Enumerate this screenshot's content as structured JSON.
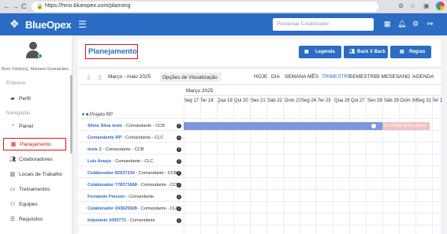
{
  "browser": {
    "back": "←",
    "forward": "→",
    "reload": "C",
    "url": "https://hmo.blueopex.com/planning"
  },
  "header": {
    "logo": "BlueOpex",
    "search_placeholder": "Pesquisar Colaborador"
  },
  "sidebar": {
    "welcome": "Bem Vindo(a), Mariane Guimarães",
    "section_empresa": "Empresa",
    "section_navegacao": "Navegação",
    "items": [
      {
        "label": "Perfil",
        "icon": "briefcase-icon"
      },
      {
        "label": "Painel",
        "icon": "dashboard-icon"
      },
      {
        "label": "Planejamento",
        "icon": "calendar-icon"
      },
      {
        "label": "Colaboradores",
        "icon": "users-icon"
      },
      {
        "label": "Locais de Trabalho",
        "icon": "building-icon"
      },
      {
        "label": "Treinamentos",
        "icon": "training-icon"
      },
      {
        "label": "Equipes",
        "icon": "team-icon"
      },
      {
        "label": "Requisitos",
        "icon": "list-icon"
      }
    ]
  },
  "page": {
    "title": "Planejamento",
    "buttons": {
      "legend": "Legenda",
      "back_x_back": "Back X Back",
      "rules": "Regras"
    }
  },
  "toolbar": {
    "date_range": "Março - maio 2025",
    "view_options": "Opções de Visualização",
    "views": [
      "HOJE",
      "DIA",
      "SEMANA",
      "MÊS",
      "TRIMESTRE",
      "SEMESTRE",
      "9 MESES",
      "ANO",
      "AGENDA"
    ],
    "selected_view": "TRIMESTRE"
  },
  "timeline": {
    "month": "Março 2025",
    "days": [
      "Seg 17",
      "Ter 18",
      "Qua 19",
      "Qui 20",
      "Sex 21",
      "Sáb 22",
      "Dom 23",
      "Seg 24",
      "Ter 25",
      "Qua 26",
      "Qui 27",
      "Sex 28",
      "Sáb 29",
      "Dom 30",
      "Seg 31",
      "Ter 1"
    ]
  },
  "gantt": {
    "project": "Projeto RP",
    "people": [
      {
        "name": "Silvio Silva teste",
        "role": " - Comandante - CCB"
      },
      {
        "name": "Comandante RP",
        "role": " - Comandante - CLC"
      },
      {
        "name": "teste 2",
        "role": " - Comandante - CCB"
      },
      {
        "name": "Luiz Araujo",
        "role": " - Comandante - CLC"
      },
      {
        "name": "Colaborador 82537334",
        "role": " - Comandante - CCB"
      },
      {
        "name": "Colaborador 778371668",
        "role": " - Comandante - CCB"
      },
      {
        "name": "Fernando Peixoto",
        "role": " - Comandante"
      },
      {
        "name": "Colaborador 243625928",
        "role": " - Comandante - CLC"
      },
      {
        "name": "tripulante 1000772",
        "role": " - Comandante"
      }
    ],
    "pink_bar_label": "Sc CHAA Sobre Aviso"
  }
}
